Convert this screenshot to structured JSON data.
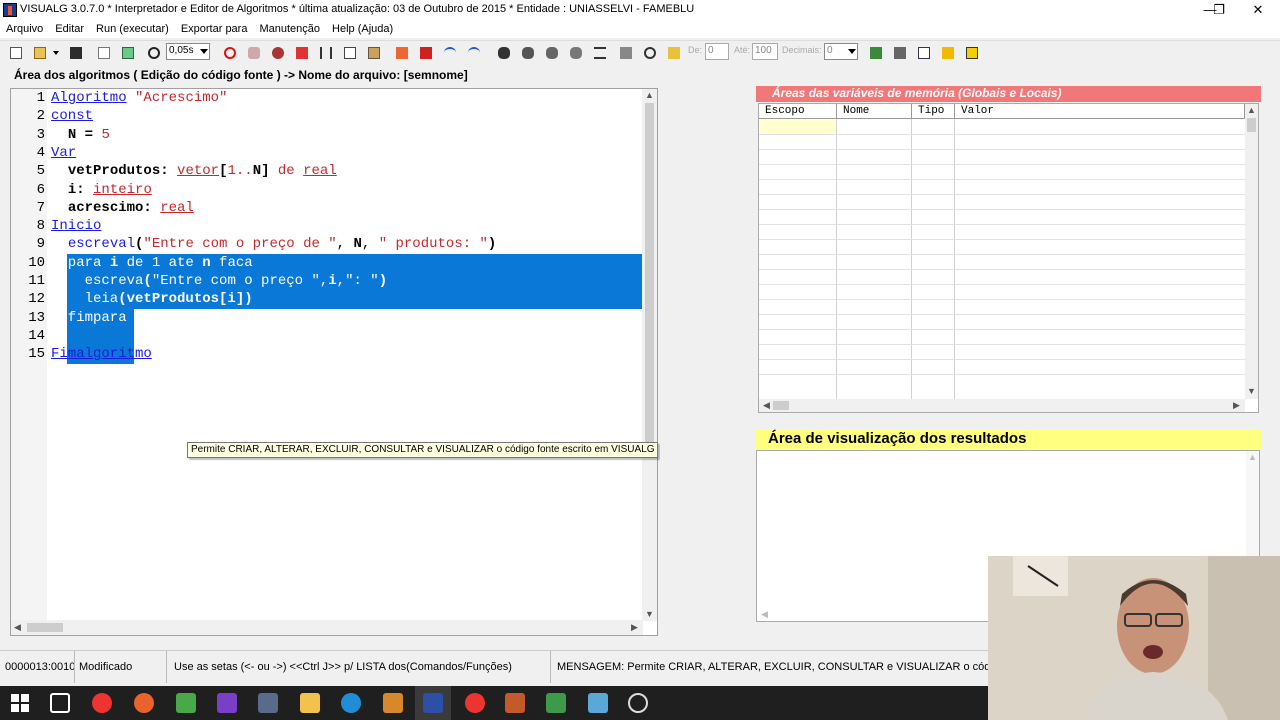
{
  "window": {
    "title": "VISUALG 3.0.7.0 * Interpretador e Editor de Algoritmos * última atualização: 03 de Outubro de 2015 * Entidade : UNIASSELVI - FAMEBLU",
    "minimize": "—",
    "maximize": "❐",
    "close": "✕"
  },
  "menu": {
    "items": [
      "Arquivo",
      "Editar",
      "Run (executar)",
      "Exportar para",
      "Manutenção",
      "Help (Ajuda)"
    ]
  },
  "toolbar": {
    "speed_value": "0,05s",
    "de_label": "De:",
    "de_value": "0",
    "ate_label": "Até:",
    "ate_value": "100",
    "decimais_label": "Decimais:",
    "decimais_value": "0"
  },
  "editor": {
    "header": "Área dos algoritmos ( Edição do código fonte ) -> Nome do arquivo: [semnome]",
    "selected_lines": [
      10,
      13
    ]
  },
  "tooltip": "Permite CRIAR, ALTERAR, EXCLUIR, CONSULTAR e VISUALIZAR o código fonte escrito em VISUALG",
  "variables": {
    "header": "Áreas das variáveis de memória (Globais e Locais)",
    "columns": [
      "Escopo",
      "Nome",
      "Tipo",
      "Valor"
    ]
  },
  "results": {
    "header": "Área de visualização dos resultados"
  },
  "status": {
    "position": "0000013:0010",
    "state": "Modificado",
    "hint": "Use as setas (<- ou ->) <<Ctrl J>> p/ LISTA dos(Comandos/Funções)",
    "message": "MENSAGEM: Permite CRIAR, ALTERAR, EXCLUIR, CONSULTAR e VISUALIZAR o código for"
  },
  "colors": {
    "selection": "#0a78d6",
    "keyword": "#1b1be0",
    "string": "#c4282c",
    "variables_header": "#f07878",
    "results_header": "#ffff80"
  }
}
